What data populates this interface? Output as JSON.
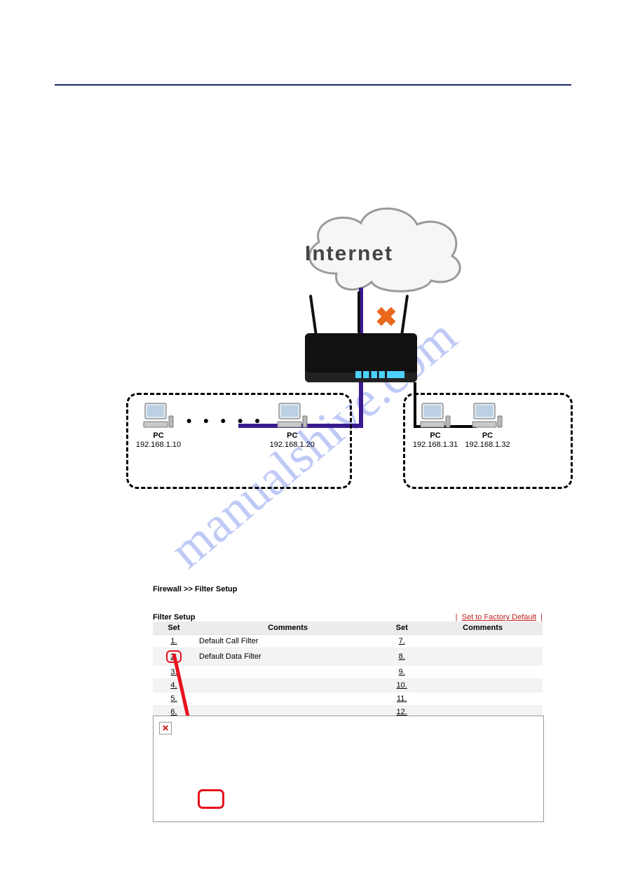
{
  "diagram": {
    "cloud_label": "Internet",
    "pc_left_1_name": "PC",
    "pc_left_1_ip": "192.168.1.10",
    "pc_left_2_name": "PC",
    "pc_left_2_ip": "192.168.1.20",
    "pc_right_1_name": "PC",
    "pc_right_1_ip": "192.168.1.31",
    "pc_right_2_name": "PC",
    "pc_right_2_ip": "192.168.1.32",
    "dots": "● ● ● ● ●"
  },
  "breadcrumb": "Firewall >> Filter Setup",
  "filter": {
    "title": "Filter Setup",
    "reset_link": "Set to Factory Default",
    "col_set": "Set",
    "col_comments": "Comments",
    "rows_left": [
      {
        "n": "1.",
        "c": "Default Call Filter"
      },
      {
        "n": "2.",
        "c": "Default Data Filter"
      },
      {
        "n": "3.",
        "c": ""
      },
      {
        "n": "4.",
        "c": ""
      },
      {
        "n": "5.",
        "c": ""
      },
      {
        "n": "6.",
        "c": ""
      }
    ],
    "rows_right": [
      {
        "n": "7.",
        "c": ""
      },
      {
        "n": "8.",
        "c": ""
      },
      {
        "n": "9.",
        "c": ""
      },
      {
        "n": "10.",
        "c": ""
      },
      {
        "n": "11.",
        "c": ""
      },
      {
        "n": "12.",
        "c": ""
      }
    ]
  },
  "panel2": {
    "x": "✕"
  }
}
